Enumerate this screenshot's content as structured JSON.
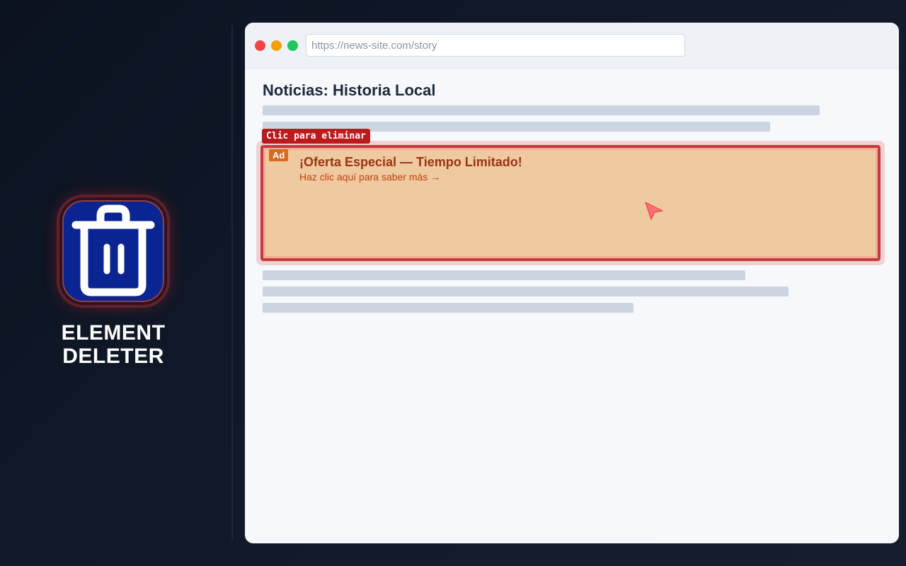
{
  "app": {
    "name_line1": "ELEMENT",
    "name_line2": "DELETER",
    "icon": "trash-icon"
  },
  "browser": {
    "url": "https://news-site.com/story",
    "window_controls": [
      "close",
      "minimize",
      "maximize"
    ]
  },
  "page": {
    "title": "Noticias: Historia Local"
  },
  "overlay": {
    "hint_label": "Clic para eliminar",
    "highlight_color": "#dc2626"
  },
  "ad": {
    "badge": "Ad",
    "headline": "¡Oferta Especial — Tiempo Limitado!",
    "link_text": "Haz clic aquí para saber más →",
    "background_color": "#efc9a0"
  },
  "colors": {
    "background": "#0f1623",
    "accent": "#0a2492",
    "danger": "#b91c1c"
  }
}
